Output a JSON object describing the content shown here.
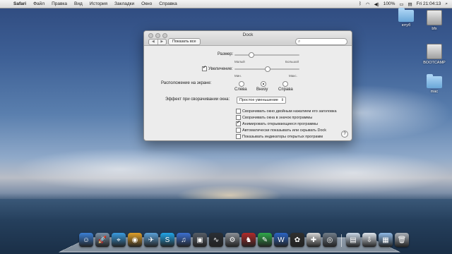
{
  "menubar": {
    "apple": "",
    "app": "Safari",
    "items": [
      "Файл",
      "Правка",
      "Вид",
      "История",
      "Закладки",
      "Окно",
      "Справка"
    ],
    "battery": "100%",
    "clock": "Fri 21:04:13"
  },
  "desktop_icons": [
    {
      "label": "ютуб",
      "kind": "folder-icon"
    },
    {
      "label": "bfx",
      "kind": "drive-icon"
    },
    {
      "label": "BOOTCAMP",
      "kind": "drive-icon"
    },
    {
      "label": "mac",
      "kind": "folder-icon"
    }
  ],
  "window": {
    "title": "Dock",
    "show_all": "Показать все",
    "search_placeholder": "",
    "size_label": "Размер:",
    "size_small": "Малый",
    "size_large": "Большой",
    "size_value": 0.25,
    "magnification_label": "Увеличение:",
    "magnification_checked": true,
    "mag_min": "Мин.",
    "mag_max": "Макс.",
    "mag_value": 0.5,
    "position_label": "Расположение на экране:",
    "position_options": [
      "Слева",
      "Внизу",
      "Справа"
    ],
    "position_selected": "Внизу",
    "minimize_label": "Эффект при сворачивании окна:",
    "minimize_value": "Простое уменьшение",
    "checkboxes": [
      {
        "label": "Сворачивать окно двойным нажатием его заголовка",
        "checked": false
      },
      {
        "label": "Сворачивать окна в значок программы",
        "checked": false
      },
      {
        "label": "Анимировать открывающиеся программы",
        "checked": true
      },
      {
        "label": "Автоматически показывать или скрывать Dock",
        "checked": false
      },
      {
        "label": "Показывать индикаторы открытых программ",
        "checked": false
      }
    ],
    "help": "?"
  },
  "dock": {
    "apps": [
      {
        "name": "finder-icon",
        "glyph": "☺",
        "color": "#3b7fd6"
      },
      {
        "name": "launchpad-icon",
        "glyph": "🚀",
        "color": "#7a8fa6"
      },
      {
        "name": "safari-icon",
        "glyph": "⌖",
        "color": "#3a9be0"
      },
      {
        "name": "chrome-icon",
        "glyph": "◉",
        "color": "#e0a02a"
      },
      {
        "name": "mail-icon",
        "glyph": "✈",
        "color": "#5aa0d8"
      },
      {
        "name": "skype-icon",
        "glyph": "S",
        "color": "#21a5e8"
      },
      {
        "name": "itunes-icon",
        "glyph": "♫",
        "color": "#3c6fd1"
      },
      {
        "name": "screenshot-icon",
        "glyph": "▣",
        "color": "#555c66"
      },
      {
        "name": "activity-monitor-icon",
        "glyph": "∿",
        "color": "#2a2f35"
      },
      {
        "name": "system-preferences-icon",
        "glyph": "⚙",
        "color": "#8a8f96"
      },
      {
        "name": "chess-icon",
        "glyph": "♞",
        "color": "#b02a2a"
      },
      {
        "name": "evernote-icon",
        "glyph": "✎",
        "color": "#2fa84a"
      },
      {
        "name": "word-icon",
        "glyph": "W",
        "color": "#2b64c4"
      },
      {
        "name": "paw-icon",
        "glyph": "✿",
        "color": "#2f2f2f"
      },
      {
        "name": "boot-camp-icon",
        "glyph": "✚",
        "color": "#d8d8d8"
      },
      {
        "name": "network-icon",
        "glyph": "◎",
        "color": "#6f7b88"
      }
    ],
    "stack": [
      {
        "name": "documents-stack-icon",
        "glyph": "▤",
        "color": "#c9d8e8"
      },
      {
        "name": "downloads-stack-icon",
        "glyph": "⇩",
        "color": "#dfe6ee"
      },
      {
        "name": "applications-stack-icon",
        "glyph": "▦",
        "color": "#8fb9e6"
      },
      {
        "name": "trash-icon",
        "glyph": "🗑",
        "color": "#a9b0b8"
      }
    ]
  }
}
